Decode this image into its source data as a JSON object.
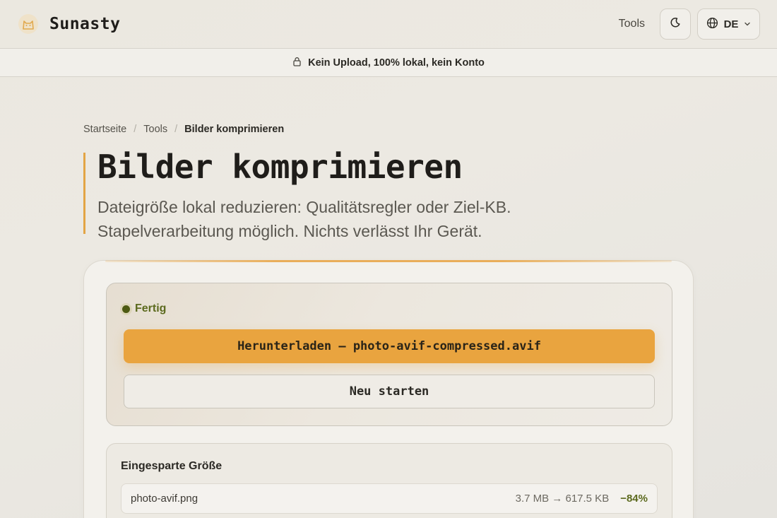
{
  "header": {
    "brand_name": "Sunasty",
    "nav_tools": "Tools",
    "language": "DE"
  },
  "notice": {
    "text": "Kein Upload, 100% lokal, kein Konto"
  },
  "breadcrumb": {
    "items": [
      "Startseite",
      "Tools"
    ],
    "separator": "/",
    "current": "Bilder komprimieren"
  },
  "page": {
    "title": "Bilder komprimieren",
    "description": "Dateigröße lokal reduzieren: Qualitätsregler oder Ziel-KB. Stapelverarbeitung möglich. Nichts verlässt Ihr Gerät."
  },
  "result": {
    "status": "Fertig",
    "download_label": "Herunterladen — photo-avif-compressed.avif",
    "restart_label": "Neu starten"
  },
  "savings": {
    "title": "Eingesparte Größe",
    "files": [
      {
        "name": "photo-avif.png",
        "sizes": "3.7 MB → 617.5 KB",
        "saving": "−84%"
      }
    ]
  },
  "colors": {
    "accent": "#e9a43f",
    "success": "#5c6a1e"
  },
  "icons": {
    "logo": "cat-logo-icon",
    "theme": "moon-icon",
    "language": "globe-icon",
    "dropdown": "chevron-down-icon",
    "notice": "lock-icon",
    "status": "status-dot-icon"
  }
}
